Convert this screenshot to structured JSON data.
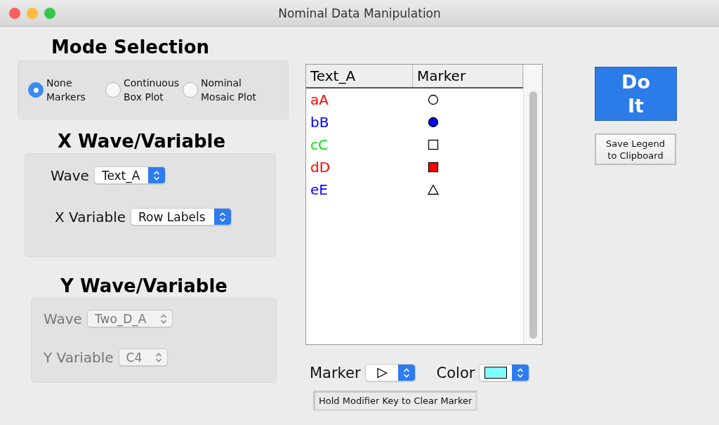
{
  "window": {
    "title": "Nominal Data Manipulation"
  },
  "mode_selection": {
    "heading": "Mode Selection",
    "options": [
      {
        "label": "None Markers",
        "selected": true
      },
      {
        "label": "Continuous Box Plot",
        "selected": false
      },
      {
        "label": "Nominal Mosaic Plot",
        "selected": false
      }
    ]
  },
  "x_section": {
    "heading": "X Wave/Variable",
    "disabled": false,
    "fields": [
      {
        "label": "Wave",
        "value": "Text_A"
      },
      {
        "label": "X Variable",
        "value": "Row Labels"
      }
    ]
  },
  "y_section": {
    "heading": "Y Wave/Variable",
    "disabled": true,
    "fields": [
      {
        "label": "Wave",
        "value": "Two_D_A"
      },
      {
        "label": "Y Variable",
        "value": "C4"
      }
    ]
  },
  "table": {
    "columns": [
      "Text_A",
      "Marker"
    ],
    "rows": [
      {
        "text": "aA",
        "color": "#ff0000",
        "kind": "circle"
      },
      {
        "text": "bB",
        "color": "#0000ff",
        "kind": "disc"
      },
      {
        "text": "cC",
        "color": "#00e000",
        "kind": "square"
      },
      {
        "text": "dD",
        "color": "#ff0000",
        "kind": "block"
      },
      {
        "text": "eE",
        "color": "#0000ff",
        "kind": "triangle"
      }
    ]
  },
  "marker_popup": {
    "label": "Marker",
    "kind": "play"
  },
  "color_popup": {
    "label": "Color",
    "color": "#80ffff"
  },
  "hint": "Hold Modifier Key to Clear Marker",
  "buttons": {
    "do_it": "Do It",
    "save_legend": "Save Legend to Clipboard"
  }
}
